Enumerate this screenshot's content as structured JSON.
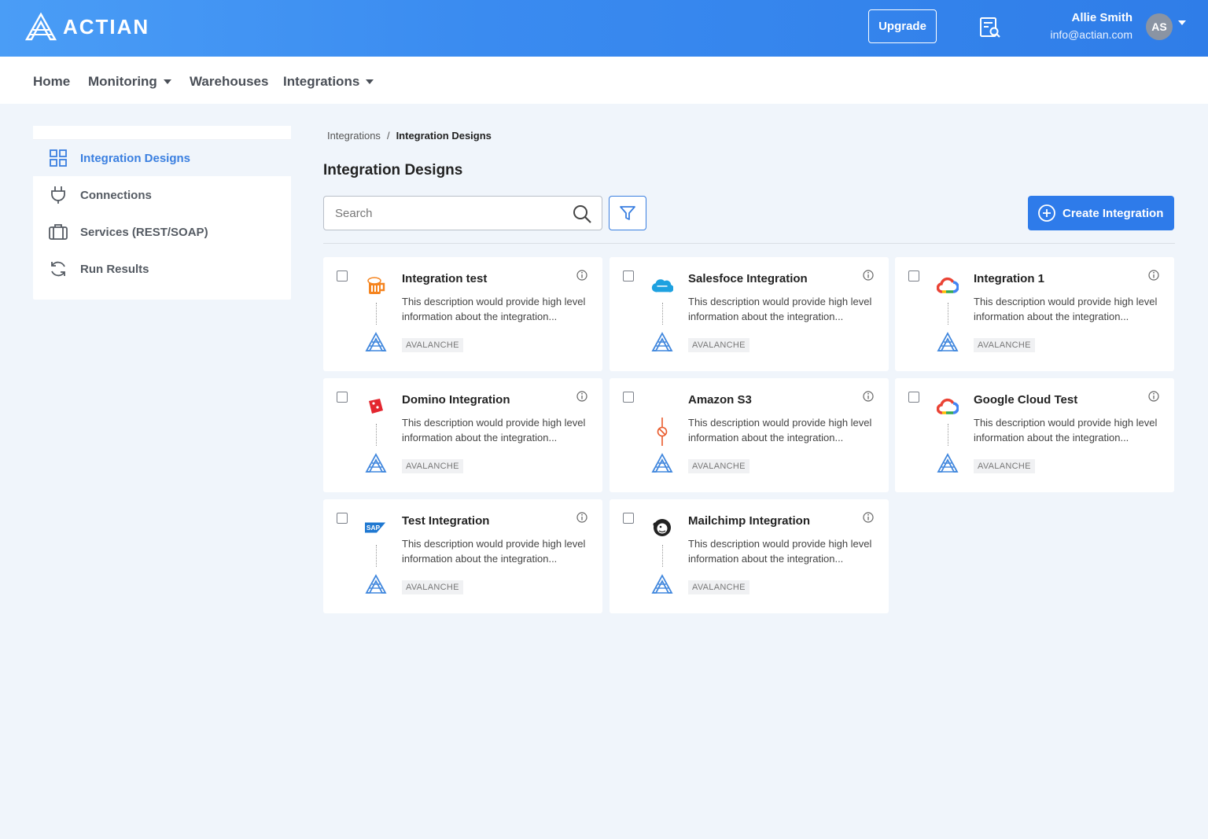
{
  "header": {
    "brand": "ACTIAN",
    "upgrade_label": "Upgrade",
    "report_icon": "report-search-icon",
    "user": {
      "name": "Allie Smith",
      "email": "info@actian.com",
      "initials": "AS"
    }
  },
  "nav": {
    "items": [
      {
        "label": "Home",
        "has_caret": false
      },
      {
        "label": "Monitoring",
        "has_caret": true
      },
      {
        "label": "Warehouses",
        "has_caret": false
      },
      {
        "label": "Integrations",
        "has_caret": true
      }
    ]
  },
  "sidebar": {
    "items": [
      {
        "label": "Integration Designs",
        "icon": "grid-icon",
        "active": true
      },
      {
        "label": "Connections",
        "icon": "plug-icon",
        "active": false
      },
      {
        "label": "Services (REST/SOAP)",
        "icon": "briefcase-icon",
        "active": false
      },
      {
        "label": "Run Results",
        "icon": "refresh-icon",
        "active": false
      }
    ]
  },
  "breadcrumb": {
    "parent": "Integrations",
    "separator": "/",
    "current": "Integration Designs"
  },
  "page": {
    "title": "Integration Designs",
    "search_placeholder": "Search",
    "create_label": "Create Integration"
  },
  "cards": [
    {
      "title": "Integration test",
      "desc": "This description would provide high level information about the integration...",
      "target": "AVALANCHE",
      "source_icon": "beer-mug-icon"
    },
    {
      "title": "Salesfoce Integration",
      "desc": "This description would provide high level information about the integration...",
      "target": "AVALANCHE",
      "source_icon": "salesforce-cloud-icon"
    },
    {
      "title": "Integration 1",
      "desc": "This description would provide high level information about the integration...",
      "target": "AVALANCHE",
      "source_icon": "google-cloud-icon"
    },
    {
      "title": "Domino Integration",
      "desc": "This description would provide high level information about the integration...",
      "target": "AVALANCHE",
      "source_icon": "domino-icon"
    },
    {
      "title": "Amazon S3",
      "desc": "This description would provide high level information about the integration...",
      "target": "AVALANCHE",
      "source_icon": "connector-disabled-icon"
    },
    {
      "title": "Google Cloud Test",
      "desc": "This description would provide high level information about the integration...",
      "target": "AVALANCHE",
      "source_icon": "google-cloud-icon"
    },
    {
      "title": "Test Integration",
      "desc": "This description would provide high level information about the integration...",
      "target": "AVALANCHE",
      "source_icon": "sap-icon"
    },
    {
      "title": "Mailchimp Integration",
      "desc": "This description would provide high level information about the integration...",
      "target": "AVALANCHE",
      "source_icon": "mailchimp-icon"
    }
  ],
  "colors": {
    "primary": "#2e7bea",
    "header_start": "#4a9df6",
    "header_end": "#2f7de8",
    "background": "#f0f5fb"
  }
}
